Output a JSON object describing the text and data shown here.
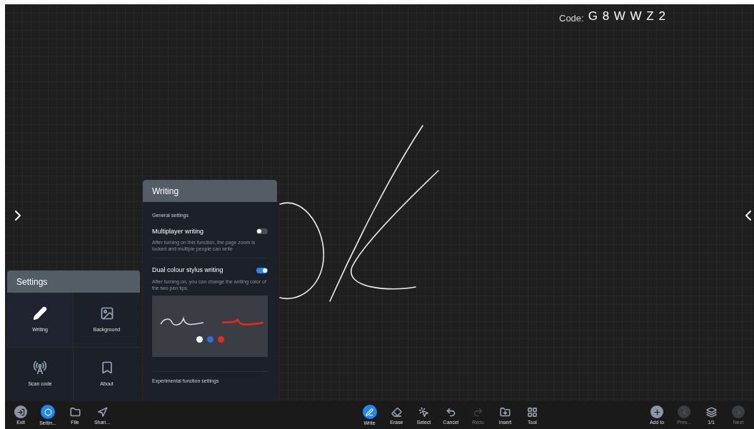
{
  "code": {
    "label": "Code:",
    "value": "G 8 W W Z 2"
  },
  "settings": {
    "title": "Settings",
    "items": [
      {
        "kind": "writing",
        "label": "Writing",
        "selected": true
      },
      {
        "kind": "background",
        "label": "Background",
        "selected": false
      },
      {
        "kind": "scan",
        "label": "Scan code",
        "selected": false
      },
      {
        "kind": "about",
        "label": "About",
        "selected": false
      }
    ]
  },
  "writing": {
    "title": "Writing",
    "section": "General settings",
    "options": [
      {
        "label": "Multiplayer writing",
        "description": "After turning on this function, the page zoom is locked and multiple people can write",
        "on": false,
        "preview": false
      },
      {
        "label": "Dual colour stylus writing",
        "description": "After turning on, you can change the writing color of the two pen tips.",
        "on": true,
        "preview": true
      }
    ],
    "pen_colors": [
      {
        "color": "#ffffff"
      },
      {
        "color": "#2f6fe0"
      },
      {
        "color": "#e82a1e"
      }
    ],
    "section_2": "Experimental function settings"
  },
  "toolbar": {
    "left": [
      {
        "kind": "exit",
        "label": "Exit",
        "selected": false
      },
      {
        "kind": "settings",
        "label": "Settin...",
        "selected": true
      },
      {
        "kind": "file",
        "label": "File",
        "selected": false
      },
      {
        "kind": "share",
        "label": "Shari...",
        "selected": false
      }
    ],
    "center": [
      {
        "kind": "write",
        "label": "Write",
        "selected": true,
        "disabled": false
      },
      {
        "kind": "erase",
        "label": "Erase",
        "selected": false,
        "disabled": false
      },
      {
        "kind": "select",
        "label": "Select",
        "selected": false,
        "disabled": false
      },
      {
        "kind": "cancel",
        "label": "Cancel",
        "selected": false,
        "disabled": false
      },
      {
        "kind": "redo",
        "label": "Redo",
        "selected": false,
        "disabled": true
      },
      {
        "kind": "insert",
        "label": "Insert",
        "selected": false,
        "disabled": false
      },
      {
        "kind": "tool",
        "label": "Tool",
        "selected": false,
        "disabled": false
      }
    ],
    "right": [
      {
        "kind": "add",
        "label": "Add to",
        "disabled": false
      },
      {
        "kind": "prev",
        "label": "Prev...",
        "disabled": true
      },
      {
        "kind": "pages",
        "label": "1/1",
        "disabled": false
      },
      {
        "kind": "next",
        "label": "Next",
        "disabled": true
      }
    ]
  }
}
